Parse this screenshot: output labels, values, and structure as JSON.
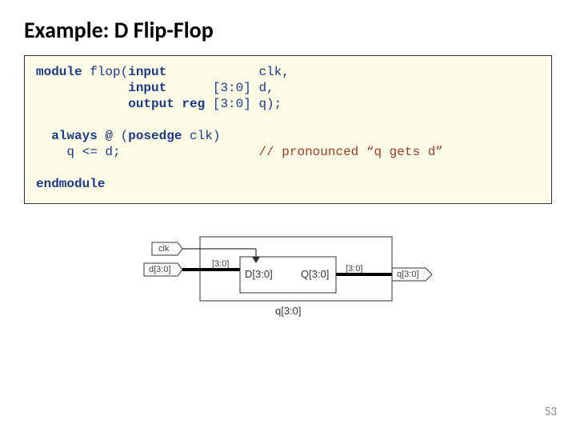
{
  "title": "Example: D Flip-Flop",
  "code": {
    "l1a": "module",
    "l1b": " flop(",
    "l1c": "input",
    "l1d": "            clk,",
    "l2a": "            ",
    "l2b": "input",
    "l2c": "      [3:0] d,",
    "l3a": "            ",
    "l3b": "output reg",
    "l3c": " [3:0] q);",
    "blank": "",
    "l4a": "  ",
    "l4b": "always @",
    "l4c": " (",
    "l4d": "posedge",
    "l4e": " clk)",
    "l5": "    q <= d;",
    "l5pad": "                  ",
    "l5comment": "// pronounced “q gets d”",
    "l6": "endmodule"
  },
  "diagram": {
    "clk": "clk",
    "d": "d[3:0]",
    "q": "q[3:0]",
    "D": "D[3:0]",
    "Q": "Q[3:0]",
    "bus1": "[3:0]",
    "bus2": "[3:0]",
    "caption": "q[3:0]"
  },
  "page": "53"
}
